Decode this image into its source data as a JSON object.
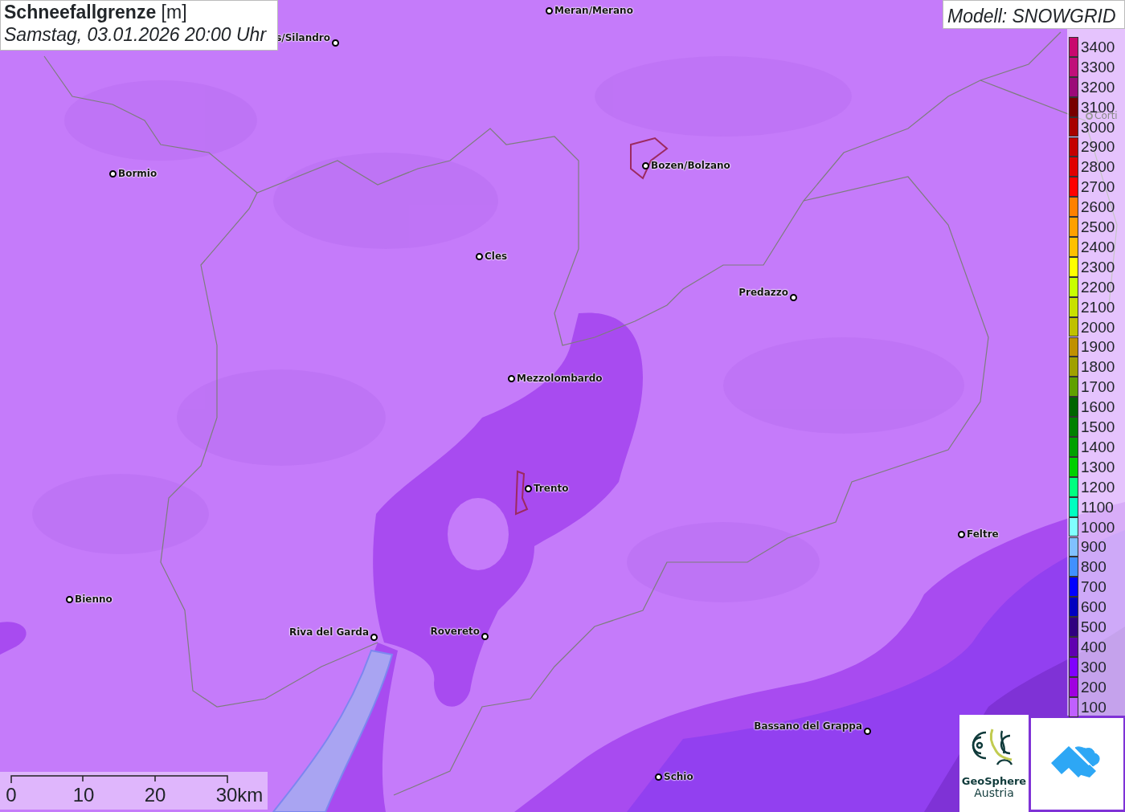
{
  "title": {
    "heading": "**Schneefallgrenze** [m]",
    "datetime": "Samstag, 03.01.2026 20:00 Uhr"
  },
  "model": "Modell: SNOWGRID",
  "cities": [
    {
      "name": "Meran/Merano",
      "faded": false
    },
    {
      "name": "s/Silandro",
      "faded": false
    },
    {
      "name": "Bormio",
      "faded": false
    },
    {
      "name": "Bozen/Bolzano",
      "faded": false
    },
    {
      "name": "Corti",
      "faded": true
    },
    {
      "name": "Cles",
      "faded": false
    },
    {
      "name": "Predazzo",
      "faded": false
    },
    {
      "name": "Mezzolombardo",
      "faded": false
    },
    {
      "name": "Trento",
      "faded": false
    },
    {
      "name": "Feltre",
      "faded": false
    },
    {
      "name": "Bienno",
      "faded": false
    },
    {
      "name": "Riva del Garda",
      "faded": false
    },
    {
      "name": "Rovereto",
      "faded": false
    },
    {
      "name": "Bassano del Grappa",
      "faded": false
    },
    {
      "name": "Schio",
      "faded": false
    }
  ],
  "legend": [
    {
      "label": "3400",
      "color": "#c8086e"
    },
    {
      "label": "3300",
      "color": "#c0107a"
    },
    {
      "label": "3200",
      "color": "#9c0a78"
    },
    {
      "label": "3100",
      "color": "#780000"
    },
    {
      "label": "3000",
      "color": "#a80000"
    },
    {
      "label": "2900",
      "color": "#c40000"
    },
    {
      "label": "2800",
      "color": "#e00000"
    },
    {
      "label": "2700",
      "color": "#ff0000"
    },
    {
      "label": "2600",
      "color": "#ff8000"
    },
    {
      "label": "2500",
      "color": "#ffa000"
    },
    {
      "label": "2400",
      "color": "#ffc000"
    },
    {
      "label": "2300",
      "color": "#ffff00"
    },
    {
      "label": "2200",
      "color": "#c8ff00"
    },
    {
      "label": "2100",
      "color": "#c8e000"
    },
    {
      "label": "2000",
      "color": "#c0c000"
    },
    {
      "label": "1900",
      "color": "#c09000"
    },
    {
      "label": "1800",
      "color": "#a0a000"
    },
    {
      "label": "1700",
      "color": "#60a000"
    },
    {
      "label": "1600",
      "color": "#006400"
    },
    {
      "label": "1500",
      "color": "#008000"
    },
    {
      "label": "1400",
      "color": "#00a000"
    },
    {
      "label": "1300",
      "color": "#00d000"
    },
    {
      "label": "1200",
      "color": "#00ff80"
    },
    {
      "label": "1100",
      "color": "#00ffc0"
    },
    {
      "label": "1000",
      "color": "#80ffff"
    },
    {
      "label": "900",
      "color": "#80c0ff"
    },
    {
      "label": "800",
      "color": "#4090ff"
    },
    {
      "label": "700",
      "color": "#0000ff"
    },
    {
      "label": "600",
      "color": "#0000c0"
    },
    {
      "label": "500",
      "color": "#300080"
    },
    {
      "label": "400",
      "color": "#6000b0"
    },
    {
      "label": "300",
      "color": "#8000ff"
    },
    {
      "label": "200",
      "color": "#a000e0"
    },
    {
      "label": "100",
      "color": "#c060ff"
    }
  ],
  "scale": {
    "labels": [
      "0",
      "10",
      "20",
      "30km"
    ]
  },
  "logo": {
    "name": "GeoSphere",
    "subtitle": "Austria"
  }
}
